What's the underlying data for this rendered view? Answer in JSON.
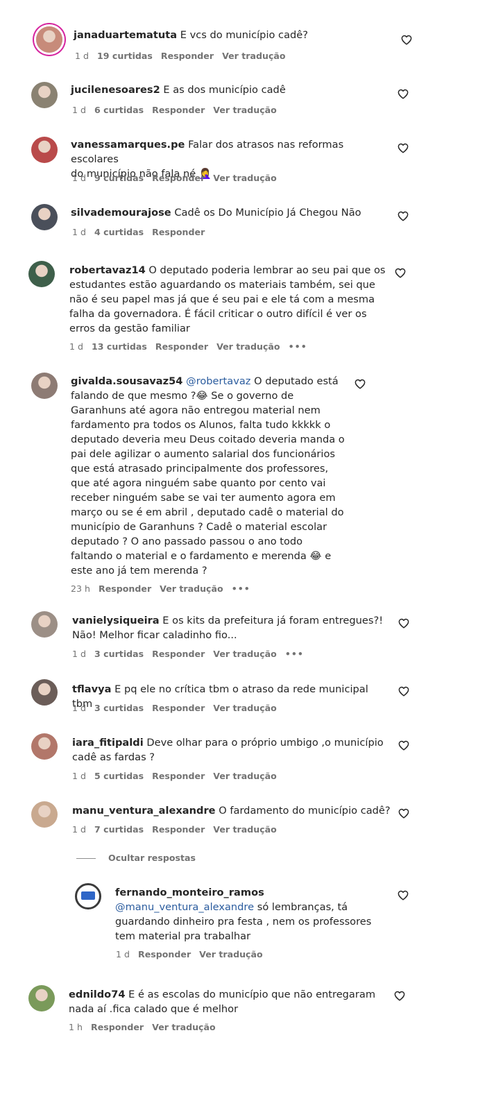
{
  "comments": [
    {
      "username": "janaduartematuta",
      "text": "E vcs do município cadê?",
      "time": "1 d",
      "likes": "19 curtidas",
      "reply": "Responder",
      "translate": "Ver tradução",
      "avatar_color": "#c78b7a"
    },
    {
      "username": "jucilenesoares2",
      "text": "E as dos município cadê",
      "time": "1 d",
      "likes": "6 curtidas",
      "reply": "Responder",
      "translate": "Ver tradução",
      "avatar_color": "#8a8272"
    },
    {
      "username": "vanessamarques.pe",
      "text": "Falar dos atrasos nas reformas escolares\ndo município não fala né 🤦‍♀️",
      "time": "1 d",
      "likes": "9 curtidas",
      "reply": "Responder",
      "translate": "Ver tradução",
      "avatar_color": "#b94a4a"
    },
    {
      "username": "silvademourajose",
      "text": "Cadê os Do Município Já Chegou Não",
      "time": "1 d",
      "likes": "4 curtidas",
      "reply": "Responder",
      "avatar_color": "#4a4f5a"
    },
    {
      "username": "robertavaz14",
      "text": "O deputado poderia lembrar ao seu pai que os\nestudantes estão aguardando os materiais também, sei que\nnão é seu papel mas já que é seu pai e ele tá com a mesma\nfalha da governadora. É fácil criticar o outro difícil é ver os\nerros da gestão familiar",
      "time": "1 d",
      "likes": "13 curtidas",
      "reply": "Responder",
      "translate": "Ver tradução",
      "more": "•••",
      "avatar_color": "#3e5f4a"
    },
    {
      "username": "givalda.sousavaz54",
      "mention": "@robertavaz",
      "text": "O deputado está\nfalando de que mesmo ?😂 Se o governo de\nGaranhuns até agora não entregou material nem\nfardamento pra todos os Alunos, falta tudo kkkkk o\ndeputado deveria meu Deus coitado deveria manda o\npai dele agilizar o aumento salarial dos funcionários\nque está atrasado principalmente dos professores,\nque até agora ninguém sabe quanto por cento vai\nreceber ninguém sabe se vai ter aumento agora em\nmarço ou se é em abril , deputado cadê o material do\nmunicípio de Garanhuns ? Cadê o material escolar\ndeputado ? O ano passado passou o ano todo\nfaltando o material e o fardamento e merenda 😂 e\neste ano já tem merenda ?",
      "time": "23 h",
      "reply": "Responder",
      "translate": "Ver tradução",
      "more": "•••",
      "avatar_color": "#8d7b74"
    },
    {
      "username": "vanielysiqueira",
      "text": "E os kits da prefeitura já foram entregues?!\nNão! Melhor ficar caladinho fio...",
      "time": "1 d",
      "likes": "3 curtidas",
      "reply": "Responder",
      "translate": "Ver tradução",
      "more": "•••",
      "avatar_color": "#9c8f86"
    },
    {
      "username": "tflavya",
      "text": "E pq ele no crítica tbm o atraso da rede municipal tbm",
      "time": "1 d",
      "likes": "3 curtidas",
      "reply": "Responder",
      "translate": "Ver tradução",
      "avatar_color": "#6b5d58"
    },
    {
      "username": "iara_fitipaldi",
      "text": "Deve olhar para o próprio umbigo ,o município\ncadê as fardas ?",
      "time": "1 d",
      "likes": "5 curtidas",
      "reply": "Responder",
      "translate": "Ver tradução",
      "avatar_color": "#b2776a"
    },
    {
      "username": "manu_ventura_alexandre",
      "text": "O fardamento do município cadê?",
      "time": "1 d",
      "likes": "7 curtidas",
      "reply": "Responder",
      "translate": "Ver tradução",
      "avatar_color": "#c9a98f"
    }
  ],
  "hide_replies_label": "Ocultar respostas",
  "reply_comment": {
    "username": "fernando_monteiro_ramos",
    "mention": "@manu_ventura_alexandre",
    "text": "só lembranças, tá\nguardando dinheiro pra festa , nem os professores\ntem material pra trabalhar",
    "time": "1 d",
    "reply": "Responder",
    "translate": "Ver tradução"
  },
  "last_comment": {
    "username": "ednildo74",
    "text": "E é as escolas do município que não entregaram\nnada aí .fica calado que é melhor",
    "time": "1 h",
    "reply": "Responder",
    "translate": "Ver tradução",
    "avatar_color": "#7a9a5a"
  }
}
